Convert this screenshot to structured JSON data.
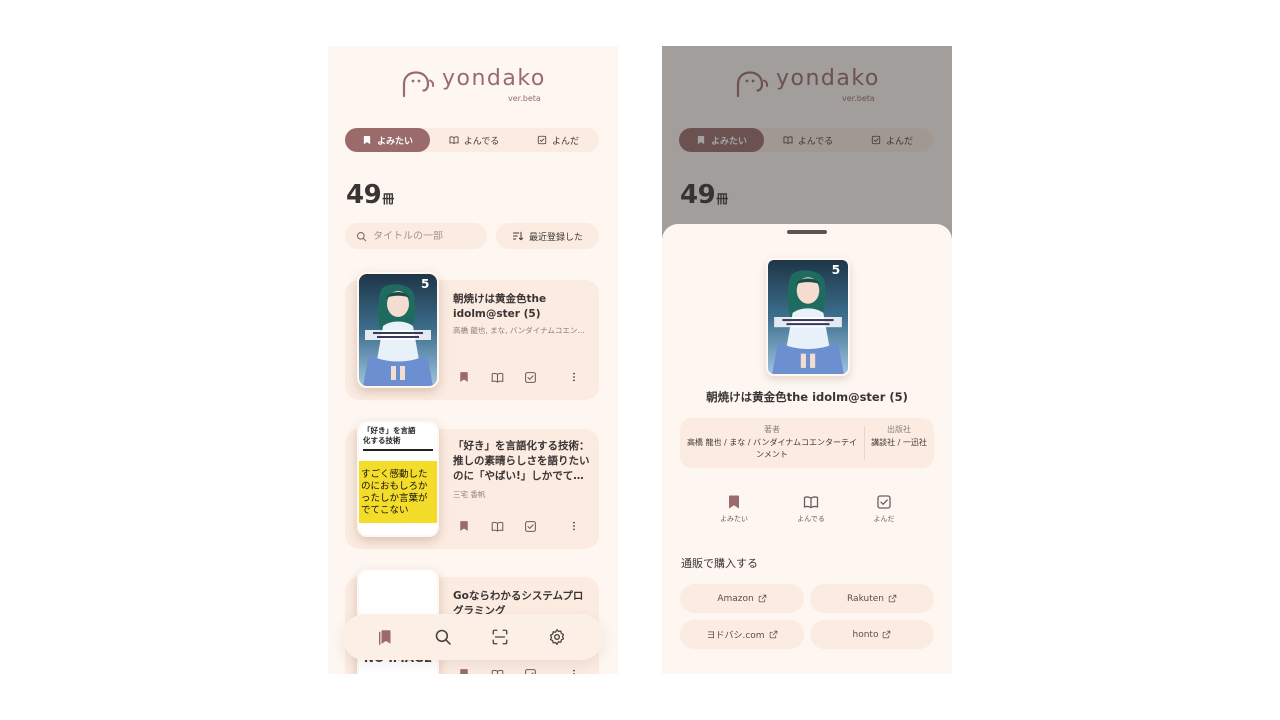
{
  "colors": {
    "accent": "#9b6b6b",
    "background": "#fdf6f1",
    "surface": "#fbebe0"
  },
  "app": {
    "logo_text": "yondako",
    "version": "ver.beta"
  },
  "tabs": [
    {
      "label": "よみたい",
      "icon": "bookmark-icon",
      "active": true
    },
    {
      "label": "よんでる",
      "icon": "open-book-icon",
      "active": false
    },
    {
      "label": "よんだ",
      "icon": "check-square-icon",
      "active": false
    }
  ],
  "library": {
    "count": "49",
    "count_unit": "冊",
    "search_placeholder": "タイトルの一部",
    "sort_label": "最近登録した"
  },
  "books": [
    {
      "title": "朝焼けは黄金色the idolm@ster (5)",
      "author": "高橋 龍也, まな, バンダイナムコエン…",
      "cover": "anime-cover"
    },
    {
      "title": "「好き」を言語化する技術：推しの素晴らしさを語りたいのに「やばい!」しかでて…",
      "author": "三宅 香帆",
      "cover": "text-cover"
    },
    {
      "title": "Goならわかるシステムプログラミング",
      "author": "",
      "cover": "no-image-cover"
    }
  ],
  "cover_texts": {
    "anime_number": "5",
    "text_cover_top": "「好き」を言語化する技術",
    "text_cover_main": "すごく感動したのにおもしろかったしか言葉がでてこない",
    "no_image": "NO IMAGE"
  },
  "bottom_nav": [
    {
      "icon": "library-icon",
      "active": true
    },
    {
      "icon": "search-icon",
      "active": false
    },
    {
      "icon": "scan-icon",
      "active": false
    },
    {
      "icon": "settings-icon",
      "active": false
    }
  ],
  "detail": {
    "title": "朝焼けは黄金色the idolm@ster (5)",
    "author_label": "著者",
    "author": "高橋 龍也 / まな / バンダイナムコエンターテインメント",
    "publisher_label": "出版社",
    "publisher": "講談社 / 一迅社",
    "statuses": [
      {
        "label": "よみたい",
        "icon": "bookmark-icon",
        "active": true
      },
      {
        "label": "よんでる",
        "icon": "open-book-icon",
        "active": false
      },
      {
        "label": "よんだ",
        "icon": "check-square-icon",
        "active": false
      }
    ],
    "shop_heading": "通販で購入する",
    "shops": [
      "Amazon",
      "Rakuten",
      "ヨドバシ.com",
      "honto"
    ]
  }
}
